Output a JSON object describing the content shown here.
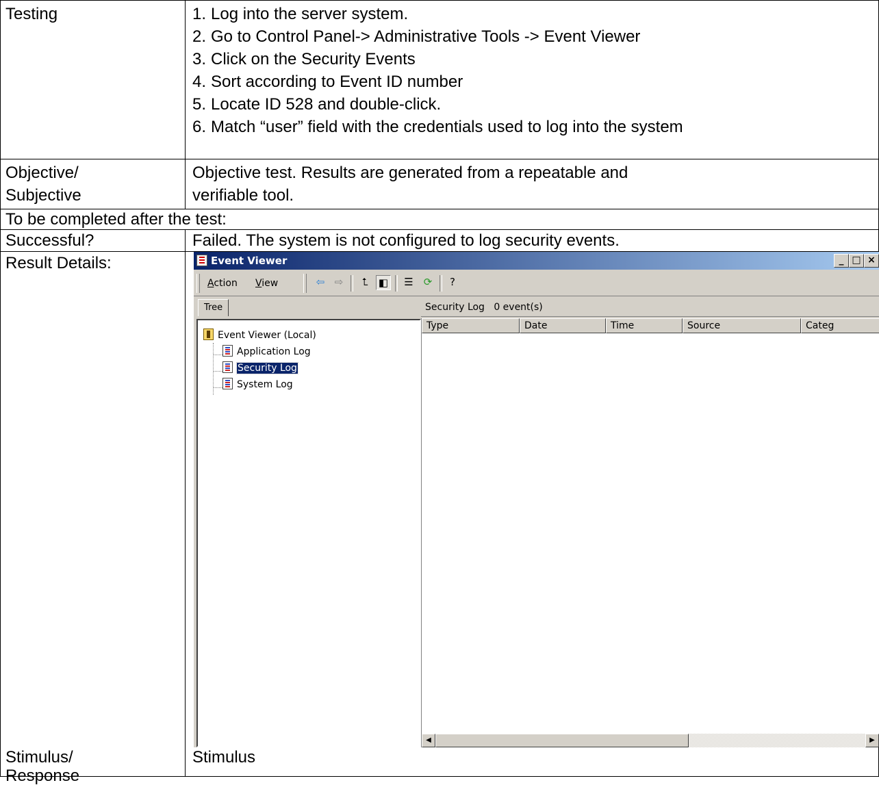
{
  "testing": {
    "label": "Testing",
    "steps": [
      {
        "num": "1.",
        "text": "Log into the server system."
      },
      {
        "num": "2.",
        "text": "Go to Control Panel-> Administrative Tools -> Event Viewer"
      },
      {
        "num": "3.",
        "text": "Click on the Security Events"
      },
      {
        "num": "4.",
        "text": "Sort according to Event ID number"
      },
      {
        "num": "5.",
        "text": "Locate ID 528 and double-click."
      },
      {
        "num": "6.",
        "text": "Match “user” field with the credentials used to log into the system"
      }
    ]
  },
  "objective": {
    "label_line1": "Objective/",
    "label_line2": "Subjective",
    "value_line1": "Objective test.  Results are generated from a repeatable and",
    "value_line2": "verifiable tool."
  },
  "after_test": {
    "text": "To be completed after the test:"
  },
  "successful": {
    "label": "Successful?",
    "value": "Failed.  The system is not configured to log security events."
  },
  "result_details": {
    "label": "Result Details:"
  },
  "stimulus": {
    "label_line1": "Stimulus/",
    "label_line2": "Response",
    "value": "Stimulus"
  },
  "event_viewer": {
    "title": "Event Viewer",
    "window_buttons": {
      "minimize": "_",
      "maximize": "□",
      "close": "×"
    },
    "menu": {
      "action": "Action",
      "action_key": "A",
      "view": "View",
      "view_key": "V"
    },
    "toolbar_icons": [
      "back-arrow-icon",
      "forward-arrow-icon",
      "up-folder-icon",
      "show-tree-icon",
      "properties-icon",
      "refresh-icon",
      "help-icon"
    ],
    "tab_label": "Tree",
    "tree": {
      "root": "Event Viewer (Local)",
      "items": [
        "Application Log",
        "Security Log",
        "System Log"
      ],
      "selected": "Security Log"
    },
    "list_title": "Security Log",
    "event_count": "0 event(s)",
    "columns": [
      "Type",
      "Date",
      "Time",
      "Source",
      "Categ"
    ]
  }
}
